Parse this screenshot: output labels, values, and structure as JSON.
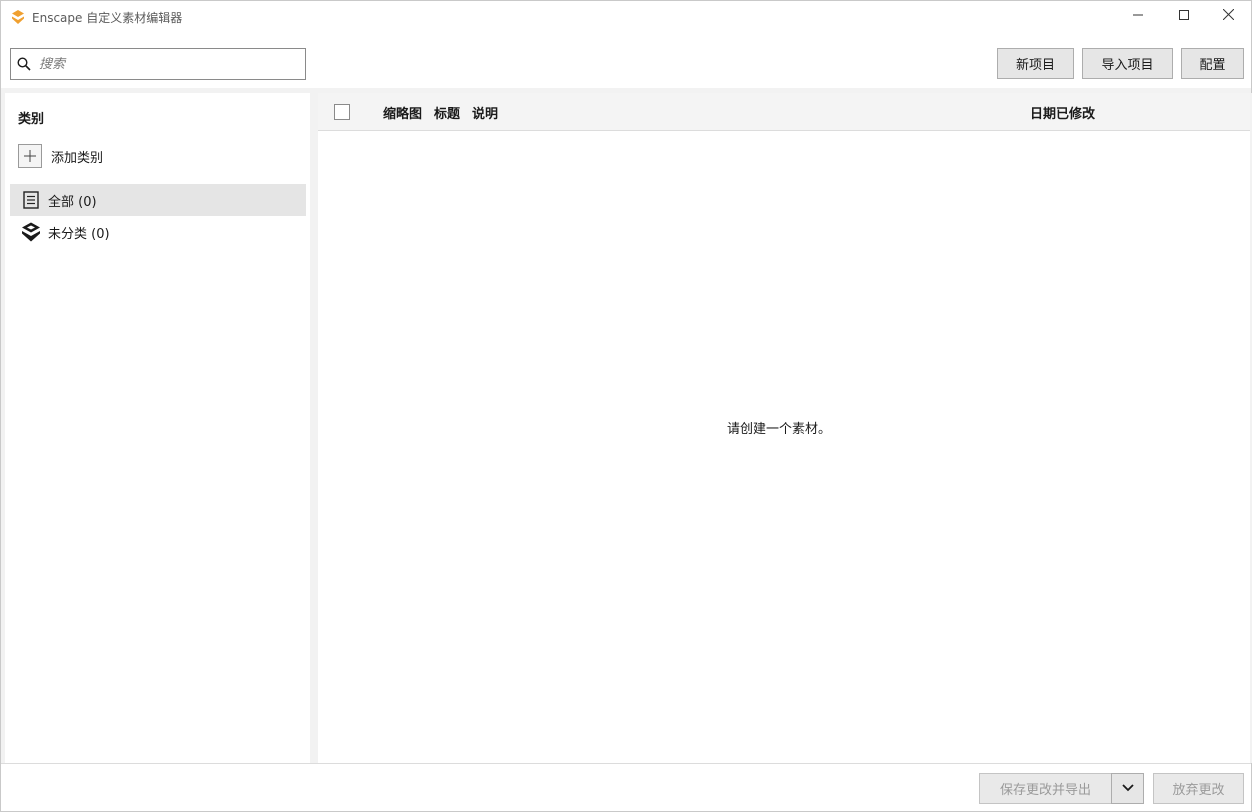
{
  "window": {
    "title": "Enscape 自定义素材编辑器",
    "accent_color": "#f0a030",
    "controls": {
      "minimize_icon": "minimize-icon",
      "maximize_icon": "maximize-icon",
      "close_icon": "close-icon"
    }
  },
  "toolbar": {
    "search": {
      "placeholder": "搜索",
      "value": "",
      "icon": "search-icon"
    },
    "new_item_label": "新项目",
    "import_label": "导入项目",
    "config_label": "配置"
  },
  "sidebar": {
    "title": "类别",
    "add_category_label": "添加类别",
    "items": [
      {
        "label": "全部 (0)",
        "icon": "list-icon",
        "selected": true
      },
      {
        "label": "未分类 (0)",
        "icon": "enscape-logo-icon",
        "selected": false
      }
    ]
  },
  "table": {
    "columns": {
      "thumbnail": "缩略图",
      "title": "标题",
      "description": "说明",
      "date_modified": "日期已修改"
    },
    "rows": [],
    "empty_message": "请创建一个素材。"
  },
  "footer": {
    "save_export_label": "保存更改并导出",
    "dropdown_icon": "chevron-down-icon",
    "discard_label": "放弃更改"
  }
}
